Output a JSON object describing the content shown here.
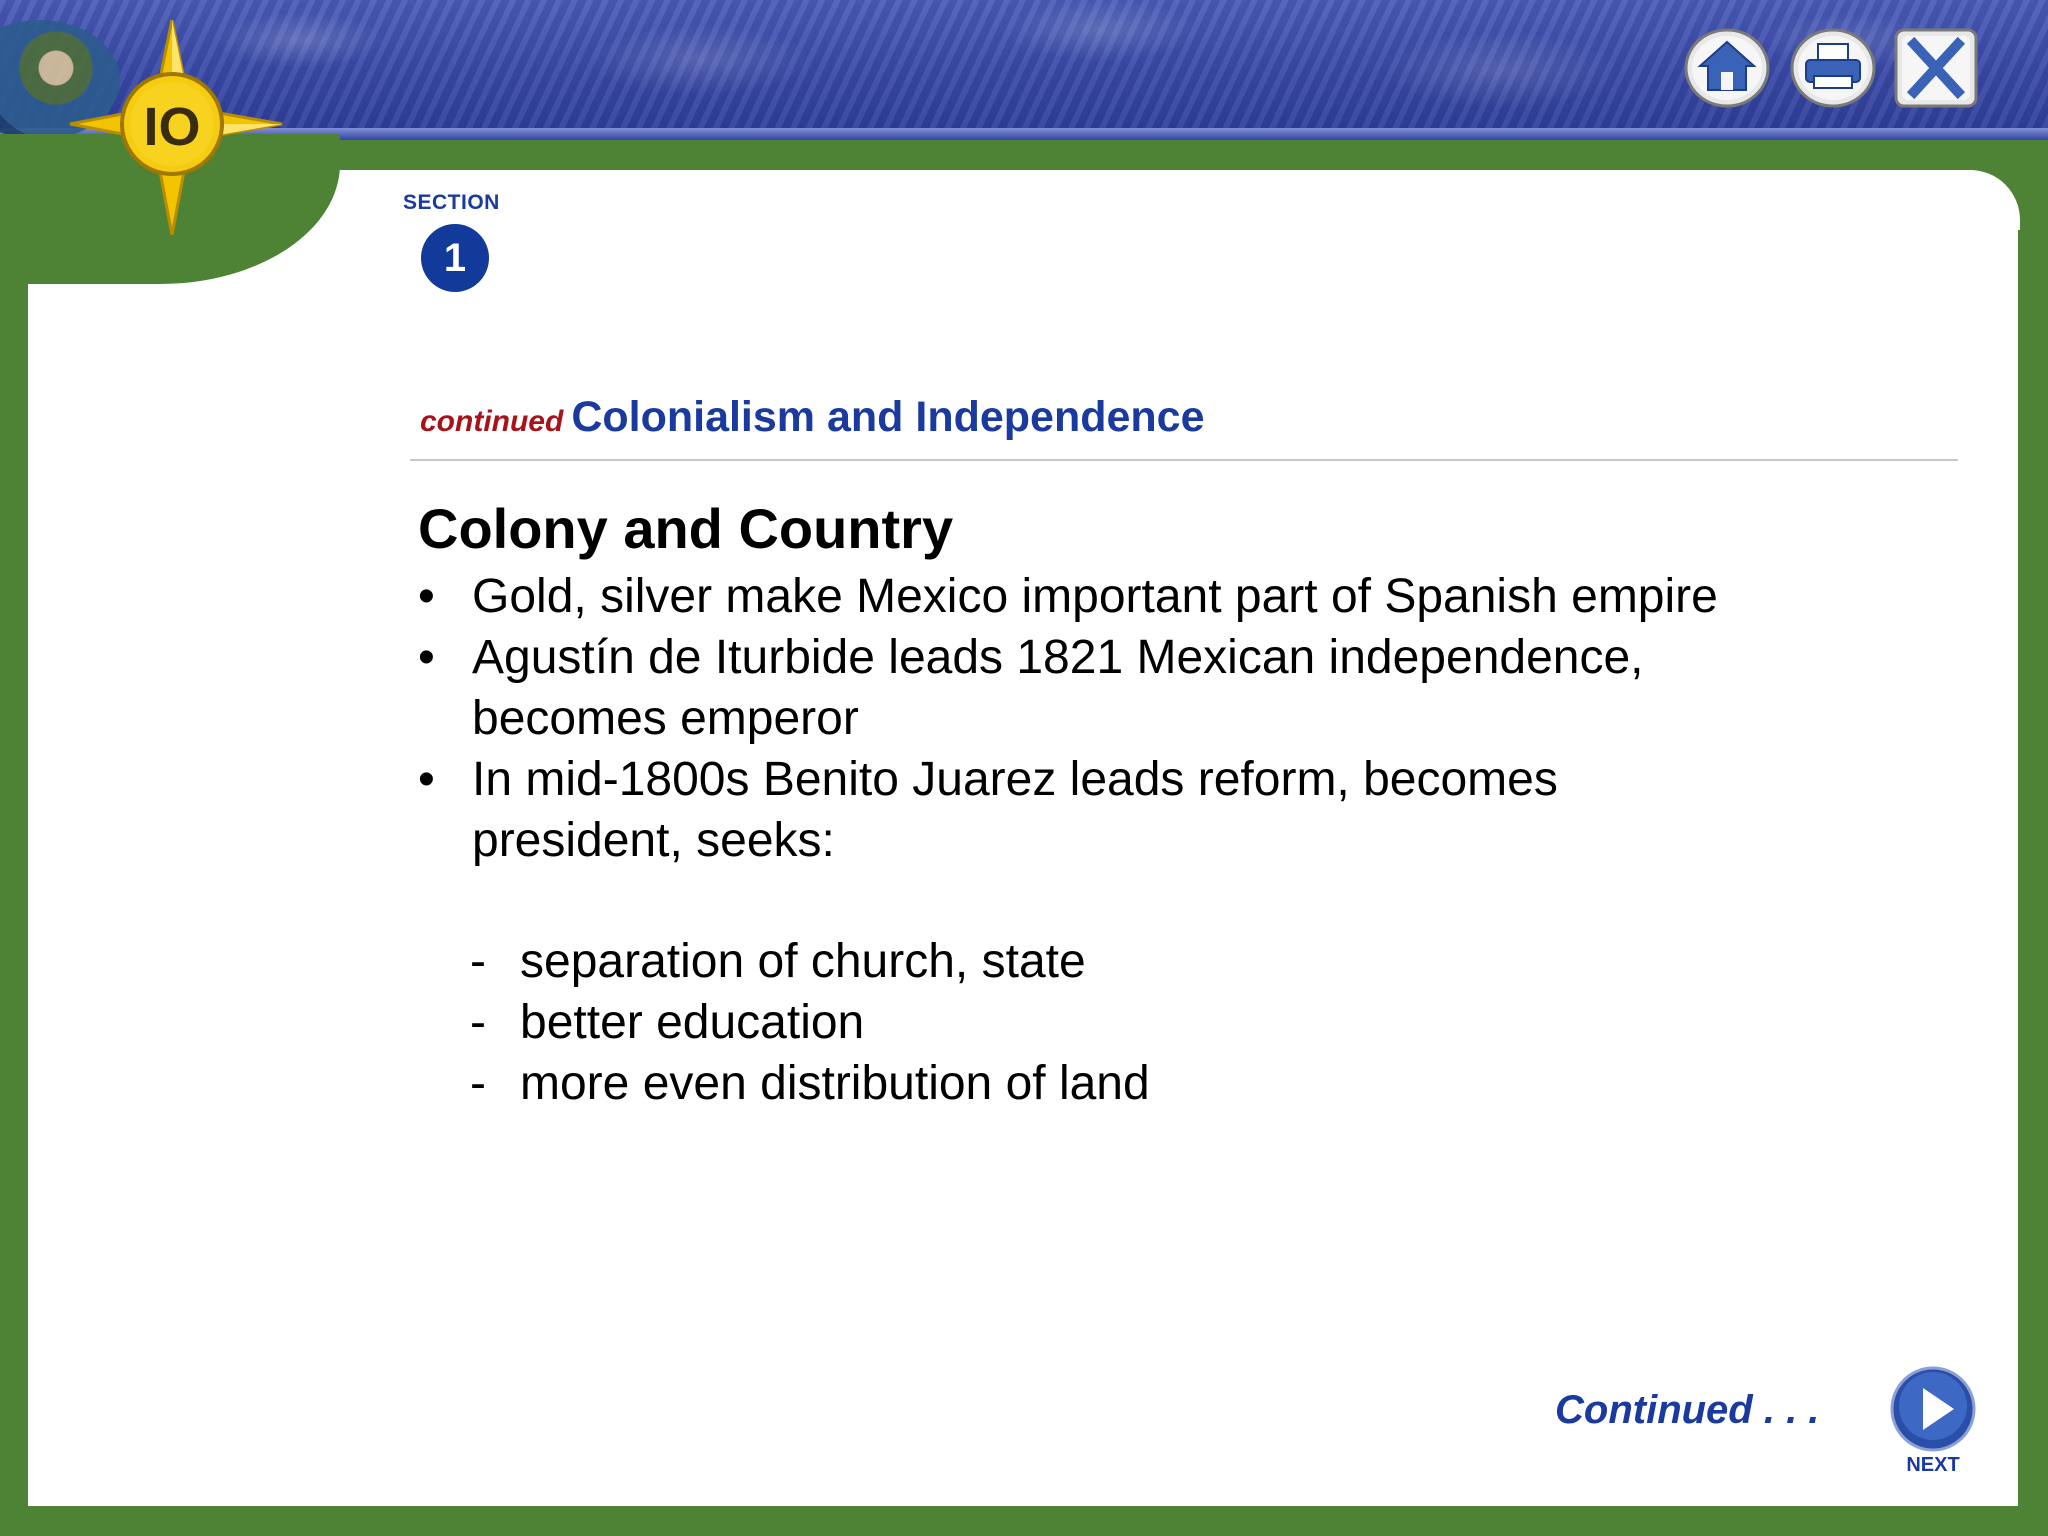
{
  "logo": {
    "text": "IO"
  },
  "toolbar": {
    "home_icon": "home-icon",
    "print_icon": "print-icon",
    "close_icon": "close-icon"
  },
  "section": {
    "label": "SECTION",
    "number": "1"
  },
  "title": {
    "continued": "continued",
    "main": "Colonialism and Independence"
  },
  "slide": {
    "heading": "Colony and Country",
    "bullets": [
      {
        "mark": "•",
        "text": "Gold, silver make Mexico important part of Spanish empire"
      },
      {
        "mark": "•",
        "text": "Agustín de Iturbide leads 1821 Mexican independence, becomes emperor"
      },
      {
        "mark": "•",
        "text": "In mid-1800s Benito Juarez leads reform, becomes president, seeks:"
      }
    ],
    "sub_items": [
      {
        "mark": "-",
        "text": "separation of church, state"
      },
      {
        "mark": "-",
        "text": "better education"
      },
      {
        "mark": "-",
        "text": "more even distribution of land"
      }
    ]
  },
  "footer": {
    "continued_note": "Continued . . .",
    "next_label": "NEXT"
  },
  "colors": {
    "green_frame": "#4e8234",
    "blue_text": "#1b3aa0",
    "red_continued": "#a8131a",
    "logo_yellow": "#f2c400"
  }
}
